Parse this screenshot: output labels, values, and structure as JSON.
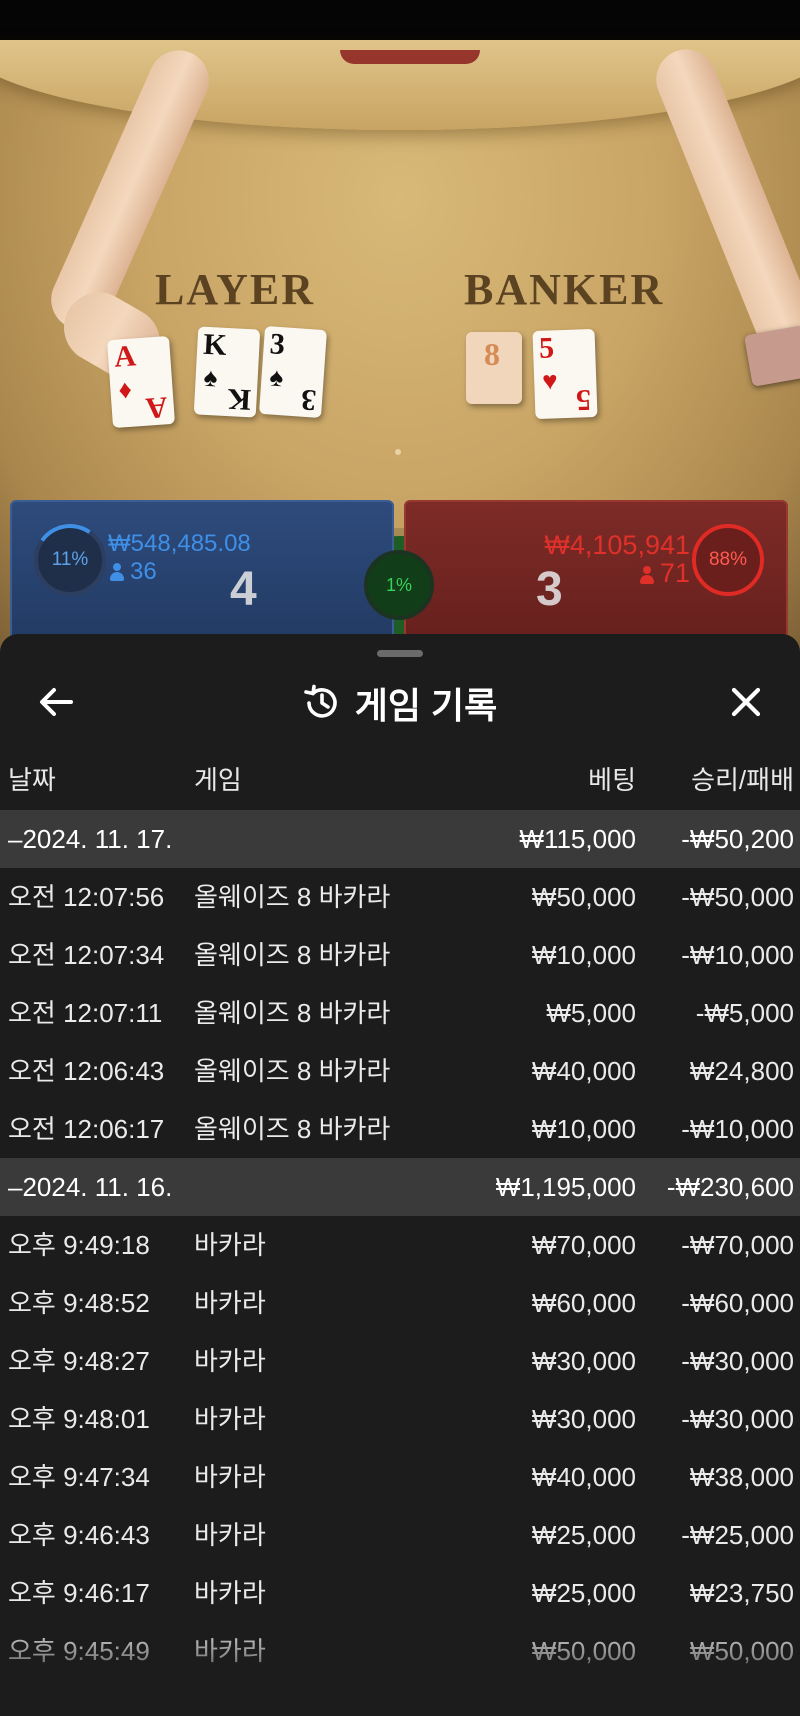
{
  "table": {
    "player_word": "LAYER",
    "banker_word": "BANKER",
    "player_cards": [
      {
        "rank": "A",
        "suit": "♦",
        "color": "red"
      },
      {
        "rank": "K",
        "suit": "♠",
        "color": "black"
      },
      {
        "rank": "3",
        "suit": "♠",
        "color": "black"
      }
    ],
    "banker_cards": [
      {
        "rank": "8",
        "suit": "",
        "color": "tan"
      },
      {
        "rank": "5",
        "suit": "♥",
        "color": "red"
      }
    ]
  },
  "bets": {
    "player": {
      "percent": "11%",
      "amount": "₩548,485.08",
      "players": "36",
      "score": "4",
      "color": "#3f8fe6"
    },
    "tie": {
      "percent": "1%",
      "color": "#38d05a"
    },
    "banker": {
      "percent": "88%",
      "amount": "₩4,105,941",
      "players": "71",
      "score": "3",
      "color": "#e0302a"
    }
  },
  "sheet": {
    "title": "게임 기록",
    "back_icon": "arrow-left-icon",
    "history_icon": "history-icon",
    "close_icon": "close-icon"
  },
  "columns": {
    "date": "날짜",
    "game": "게임",
    "bet": "베팅",
    "result": "승리/패배"
  },
  "groups": [
    {
      "date": "–2024. 11. 17.",
      "bet": "₩115,000",
      "result": "-₩50,200",
      "rows": [
        {
          "time": "오전 12:07:56",
          "game": "올웨이즈 8 바카라",
          "bet": "₩50,000",
          "result": "-₩50,000"
        },
        {
          "time": "오전 12:07:34",
          "game": "올웨이즈 8 바카라",
          "bet": "₩10,000",
          "result": "-₩10,000"
        },
        {
          "time": "오전 12:07:11",
          "game": "올웨이즈 8 바카라",
          "bet": "₩5,000",
          "result": "-₩5,000"
        },
        {
          "time": "오전 12:06:43",
          "game": "올웨이즈 8 바카라",
          "bet": "₩40,000",
          "result": "₩24,800"
        },
        {
          "time": "오전 12:06:17",
          "game": "올웨이즈 8 바카라",
          "bet": "₩10,000",
          "result": "-₩10,000"
        }
      ]
    },
    {
      "date": "–2024. 11. 16.",
      "bet": "₩1,195,000",
      "result": "-₩230,600",
      "rows": [
        {
          "time": "오후 9:49:18",
          "game": "바카라",
          "bet": "₩70,000",
          "result": "-₩70,000"
        },
        {
          "time": "오후 9:48:52",
          "game": "바카라",
          "bet": "₩60,000",
          "result": "-₩60,000"
        },
        {
          "time": "오후 9:48:27",
          "game": "바카라",
          "bet": "₩30,000",
          "result": "-₩30,000"
        },
        {
          "time": "오후 9:48:01",
          "game": "바카라",
          "bet": "₩30,000",
          "result": "-₩30,000"
        },
        {
          "time": "오후 9:47:34",
          "game": "바카라",
          "bet": "₩40,000",
          "result": "₩38,000"
        },
        {
          "time": "오후 9:46:43",
          "game": "바카라",
          "bet": "₩25,000",
          "result": "-₩25,000"
        },
        {
          "time": "오후 9:46:17",
          "game": "바카라",
          "bet": "₩25,000",
          "result": "₩23,750"
        },
        {
          "time": "오후 9:45:49",
          "game": "바카라",
          "bet": "₩50,000",
          "result": "₩50,000"
        }
      ]
    }
  ]
}
